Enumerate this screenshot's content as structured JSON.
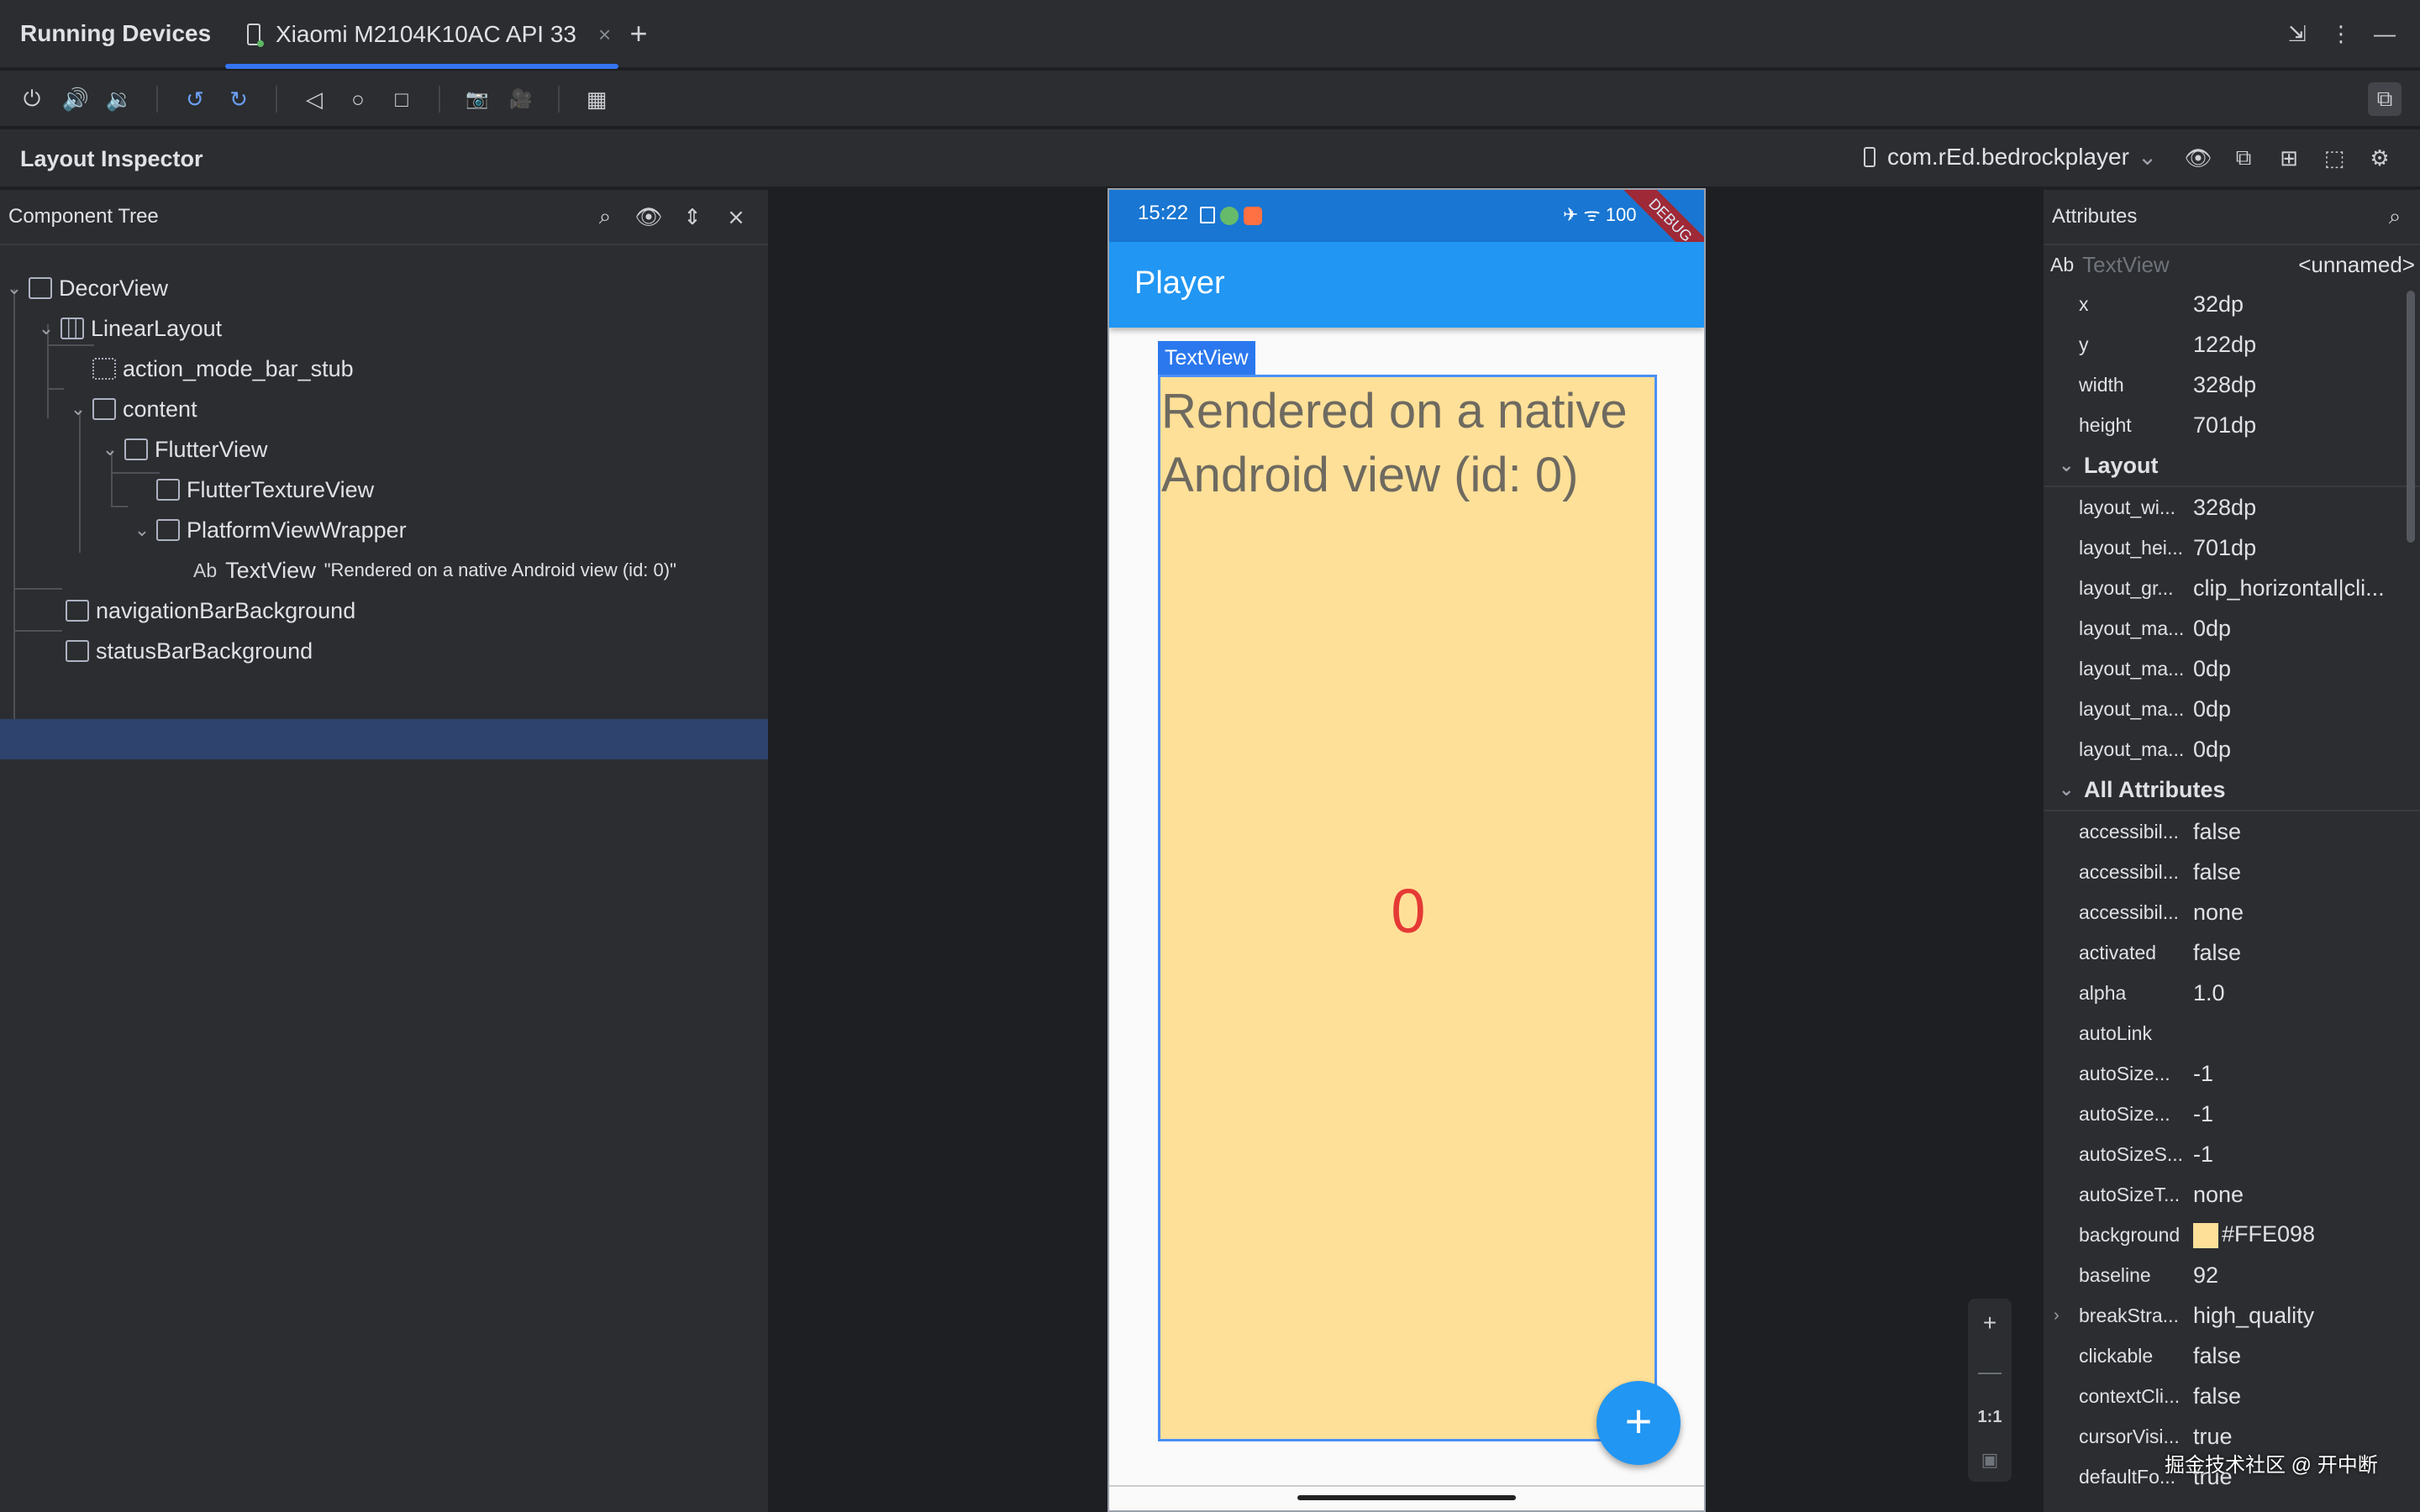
{
  "titlebar": {
    "title": "Running Devices",
    "tab_label": "Xiaomi M2104K10AC API 33",
    "tab_close": "×",
    "add_tab": "+",
    "right_icons": [
      "⇲",
      "⋮",
      "—"
    ]
  },
  "device_toolbar": {
    "icons": [
      "power-icon",
      "volume-up-icon",
      "volume-down-icon",
      "rotate-left-icon",
      "rotate-right-icon",
      "back-icon",
      "home-icon",
      "overview-icon",
      "screenshot-icon",
      "screen-record-icon",
      "device-frame-icon"
    ],
    "glyphs": [
      "⏻",
      "🔊",
      "🔉",
      "↺",
      "↻",
      "◁",
      "○",
      "□",
      "📷",
      "🎥",
      "▦"
    ],
    "right_icon": "⧉"
  },
  "inspector": {
    "title": "Layout Inspector",
    "process": "com.rEd.bedrockplayer",
    "process_chevron": "⌄"
  },
  "tree": {
    "title": "Component Tree",
    "nodes": [
      {
        "label": "DecorView"
      },
      {
        "label": "LinearLayout"
      },
      {
        "label": "action_mode_bar_stub"
      },
      {
        "label": "content"
      },
      {
        "label": "FlutterView"
      },
      {
        "label": "FlutterTextureView"
      },
      {
        "label": "PlatformViewWrapper"
      },
      {
        "label": "TextView",
        "ab": "Ab",
        "sub": "\"Rendered on a native Android view (id: 0)\""
      },
      {
        "label": "navigationBarBackground"
      },
      {
        "label": "statusBarBackground"
      }
    ]
  },
  "phone": {
    "time": "15:22",
    "ribbon": "DEBUG",
    "status_icons": "✈ ᯤ 100",
    "appbar_title": "Player",
    "tv_label": "TextView",
    "tv_text": "Rendered on a native Android view (id: 0)",
    "counter": "0",
    "fab": "+"
  },
  "zoom": {
    "plus": "+",
    "minus": "—",
    "ratio": "1:1",
    "fit": "▣"
  },
  "attributes": {
    "title": "Attributes",
    "selected_ab": "Ab",
    "selected_type": "TextView",
    "selected_name": "<unnamed>",
    "top_rows": [
      {
        "k": "x",
        "v": "32dp"
      },
      {
        "k": "y",
        "v": "122dp"
      },
      {
        "k": "width",
        "v": "328dp"
      },
      {
        "k": "height",
        "v": "701dp"
      }
    ],
    "layout_title": "Layout",
    "layout_rows": [
      {
        "k": "layout_wi...",
        "v": "328dp"
      },
      {
        "k": "layout_hei...",
        "v": "701dp"
      },
      {
        "k": "layout_gr...",
        "v": "clip_horizontal|cli..."
      },
      {
        "k": "layout_ma...",
        "v": "0dp"
      },
      {
        "k": "layout_ma...",
        "v": "0dp"
      },
      {
        "k": "layout_ma...",
        "v": "0dp"
      },
      {
        "k": "layout_ma...",
        "v": "0dp"
      }
    ],
    "all_title": "All Attributes",
    "all_rows": [
      {
        "k": "accessibil...",
        "v": "false"
      },
      {
        "k": "accessibil...",
        "v": "false"
      },
      {
        "k": "accessibil...",
        "v": "none"
      },
      {
        "k": "activated",
        "v": "false"
      },
      {
        "k": "alpha",
        "v": "1.0"
      },
      {
        "k": "autoLink",
        "v": ""
      },
      {
        "k": "autoSize...",
        "v": "-1"
      },
      {
        "k": "autoSize...",
        "v": "-1"
      },
      {
        "k": "autoSizeS...",
        "v": "-1"
      },
      {
        "k": "autoSizeT...",
        "v": "none"
      },
      {
        "k": "background",
        "v": "#FFE098",
        "swatch": "#FFE098"
      },
      {
        "k": "baseline",
        "v": "92"
      },
      {
        "k": "breakStra...",
        "v": "high_quality",
        "expand": "›"
      },
      {
        "k": "clickable",
        "v": "false"
      },
      {
        "k": "contextCli...",
        "v": "false"
      },
      {
        "k": "cursorVisi...",
        "v": "true"
      },
      {
        "k": "defaultFo...",
        "v": "true"
      }
    ]
  },
  "watermark": "掘金技术社区 @ 开中断",
  "colors": {
    "accent": "#3574f0",
    "selection": "#2e436e",
    "textview_bg": "#FFE098",
    "appbar": "#2196f3"
  }
}
